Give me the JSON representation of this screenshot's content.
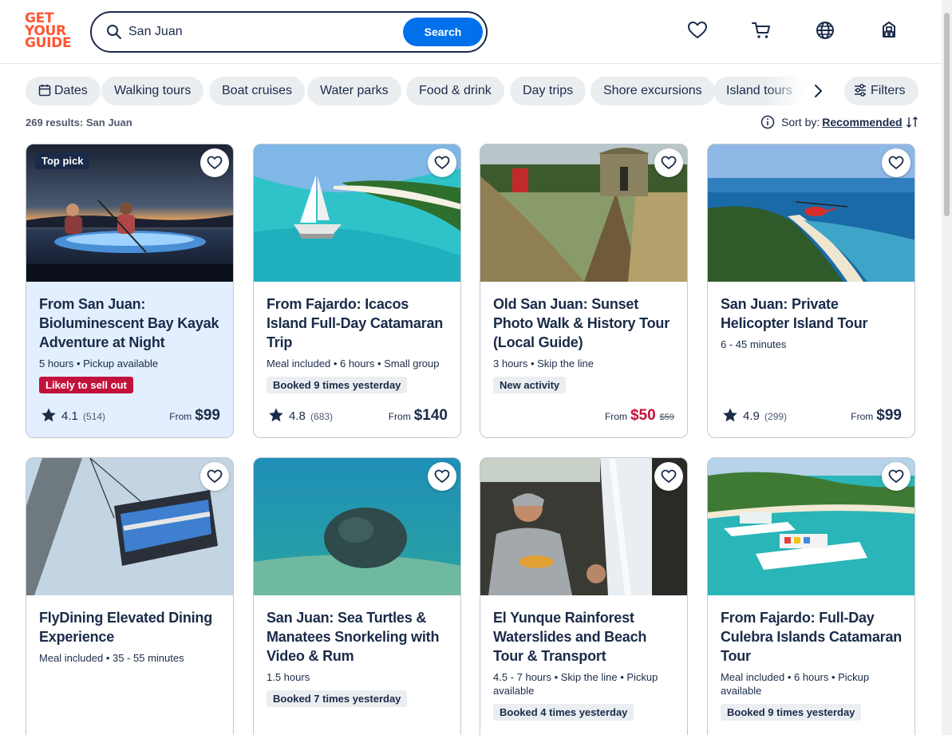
{
  "brand": {
    "logo_lines": [
      "GET",
      "YOUR",
      "GUIDE"
    ],
    "accent": "#ff5533",
    "primary": "#0071eb",
    "text": "#1a2b49"
  },
  "search": {
    "value": "San Juan",
    "button_label": "Search"
  },
  "header_icons": [
    "heart-icon",
    "cart-icon",
    "globe-icon",
    "profile-icon"
  ],
  "chips": [
    {
      "label": "Dates",
      "icon": "calendar-icon"
    },
    {
      "label": "Walking tours"
    },
    {
      "label": "Boat cruises"
    },
    {
      "label": "Water parks"
    },
    {
      "label": "Food & drink"
    },
    {
      "label": "Day trips"
    },
    {
      "label": "Shore excursions"
    },
    {
      "label": "Island tours"
    }
  ],
  "filters_label": "Filters",
  "results_text": "269 results: San Juan",
  "sort": {
    "label": "Sort by:",
    "value": "Recommended"
  },
  "cards": [
    {
      "title": "From San Juan: Bioluminescent Bay Kayak Adventure at Night",
      "meta": "5 hours • Pickup available",
      "badge": "Likely to sell out",
      "badge_style": "red",
      "tag": "Top pick",
      "rating": "4.1",
      "reviews": "(514)",
      "from": "From",
      "price": "$99"
    },
    {
      "title": "From Fajardo: Icacos Island Full-Day Catamaran Trip",
      "meta": "Meal included • 6 hours • Small group",
      "badge": "Booked 9 times yesterday",
      "rating": "4.8",
      "reviews": "(683)",
      "from": "From",
      "price": "$140"
    },
    {
      "title": "Old San Juan: Sunset Photo Walk & History Tour (Local Guide)",
      "meta": "3 hours • Skip the line",
      "badge": "New activity",
      "from": "From",
      "price": "$50",
      "original_price": "$59"
    },
    {
      "title": "San Juan: Private Helicopter Island Tour",
      "meta": "6 - 45 minutes",
      "rating": "4.9",
      "reviews": "(299)",
      "from": "From",
      "price": "$99"
    },
    {
      "title": "FlyDining Elevated Dining Experience",
      "meta": "Meal included • 35 - 55 minutes"
    },
    {
      "title": "San Juan: Sea Turtles & Manatees Snorkeling with Video & Rum",
      "meta": "1.5 hours",
      "badge": "Booked 7 times yesterday"
    },
    {
      "title": "El Yunque Rainforest Waterslides and Beach Tour & Transport",
      "meta": "4.5 - 7 hours • Skip the line • Pickup available",
      "badge": "Booked 4 times yesterday"
    },
    {
      "title": "From Fajardo: Full-Day Culebra Islands Catamaran Tour",
      "meta": "Meal included • 6 hours • Pickup available",
      "badge": "Booked 9 times yesterday"
    }
  ]
}
